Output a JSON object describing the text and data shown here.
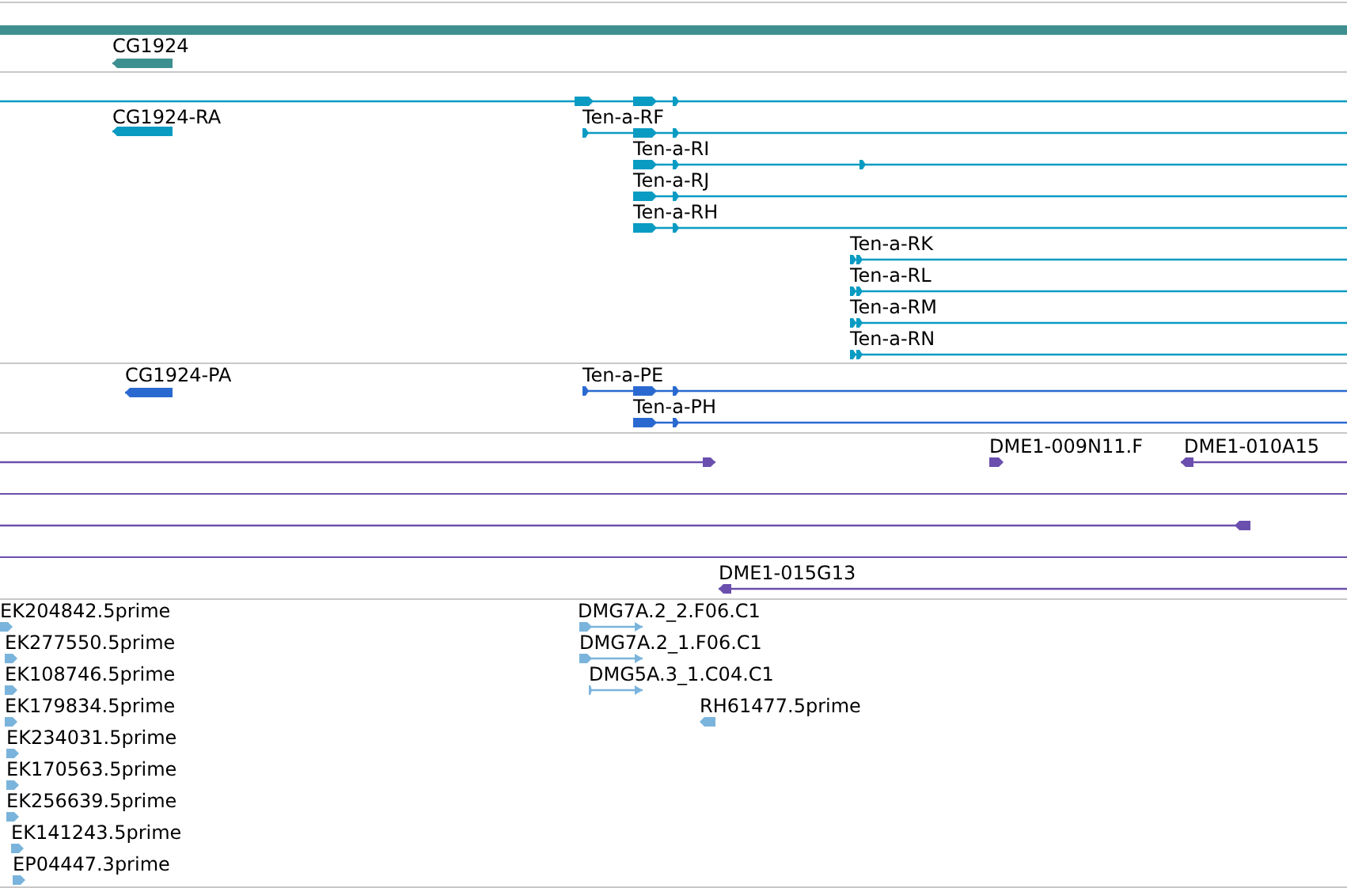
{
  "tracks": [
    {
      "kind": "gene",
      "features": [
        {
          "label": "CG1924",
          "reverse": true
        }
      ]
    },
    {
      "kind": "transcript",
      "features": [
        {
          "reverse": false
        },
        {
          "label": "CG1924-RA",
          "reverse": true
        },
        {
          "label": "Ten-a-RF",
          "reverse": false
        },
        {
          "label": "Ten-a-RI",
          "reverse": false
        },
        {
          "label": "Ten-a-RJ",
          "reverse": false
        },
        {
          "label": "Ten-a-RH",
          "reverse": false
        },
        {
          "label": "Ten-a-RK",
          "reverse": false
        },
        {
          "label": "Ten-a-RL",
          "reverse": false
        },
        {
          "label": "Ten-a-RM",
          "reverse": false
        },
        {
          "label": "Ten-a-RN",
          "reverse": false
        }
      ]
    },
    {
      "kind": "protein",
      "features": [
        {
          "label": "CG1924-PA",
          "reverse": true
        },
        {
          "label": "Ten-a-PE",
          "reverse": false
        },
        {
          "label": "Ten-a-PH",
          "reverse": false
        }
      ]
    },
    {
      "kind": "clone",
      "features": [
        {
          "reverse": false
        },
        {
          "label": "DME1-009N11.F",
          "reverse": false
        },
        {
          "label": "DME1-010A15",
          "reverse": true
        },
        {
          "reverse": true
        },
        {
          "label": "DME1-015G13",
          "reverse": true
        }
      ]
    },
    {
      "kind": "est",
      "features": [
        {
          "label": "EK204842.5prime",
          "reverse": false
        },
        {
          "label": "EK277550.5prime",
          "reverse": false
        },
        {
          "label": "EK108746.5prime",
          "reverse": false
        },
        {
          "label": "EK179834.5prime",
          "reverse": false
        },
        {
          "label": "EK234031.5prime",
          "reverse": false
        },
        {
          "label": "EK170563.5prime",
          "reverse": false
        },
        {
          "label": "EK256639.5prime",
          "reverse": false
        },
        {
          "label": "EK141243.5prime",
          "reverse": false
        },
        {
          "label": "EP04447.3prime",
          "reverse": false
        },
        {
          "label": "DMG7A.2_2.F06.C1",
          "reverse": false
        },
        {
          "label": "DMG7A.2_1.F06.C1",
          "reverse": false
        },
        {
          "label": "DMG5A.3_1.C04.C1",
          "reverse": false
        },
        {
          "label": "RH61477.5prime",
          "reverse": true
        }
      ]
    }
  ]
}
